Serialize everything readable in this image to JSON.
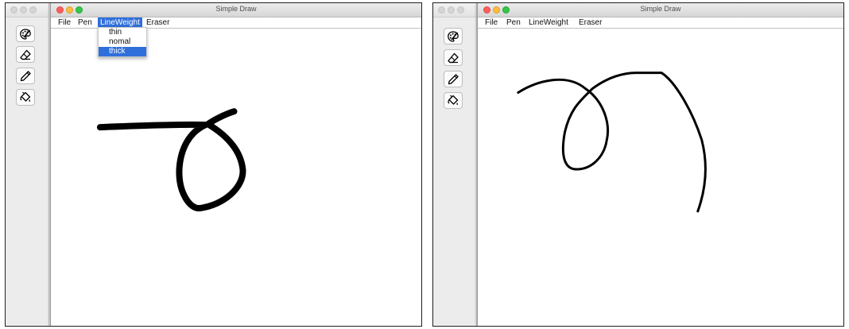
{
  "window_title": "Simple Draw",
  "menu": {
    "file": "File",
    "pen": "Pen",
    "line_weight": "LineWeight",
    "eraser": "Eraser"
  },
  "line_weight_options": [
    "thin",
    "nomal",
    "thick"
  ],
  "selected_line_weight": "thick",
  "tools": [
    "palette-icon",
    "eraser-icon",
    "pencil-icon",
    "paint-bucket-icon"
  ],
  "colors": {
    "selection": "#2f6fdb",
    "stroke": "#000000",
    "close": "#fc605c",
    "minimize": "#fdbc40",
    "zoom": "#34c84a"
  }
}
